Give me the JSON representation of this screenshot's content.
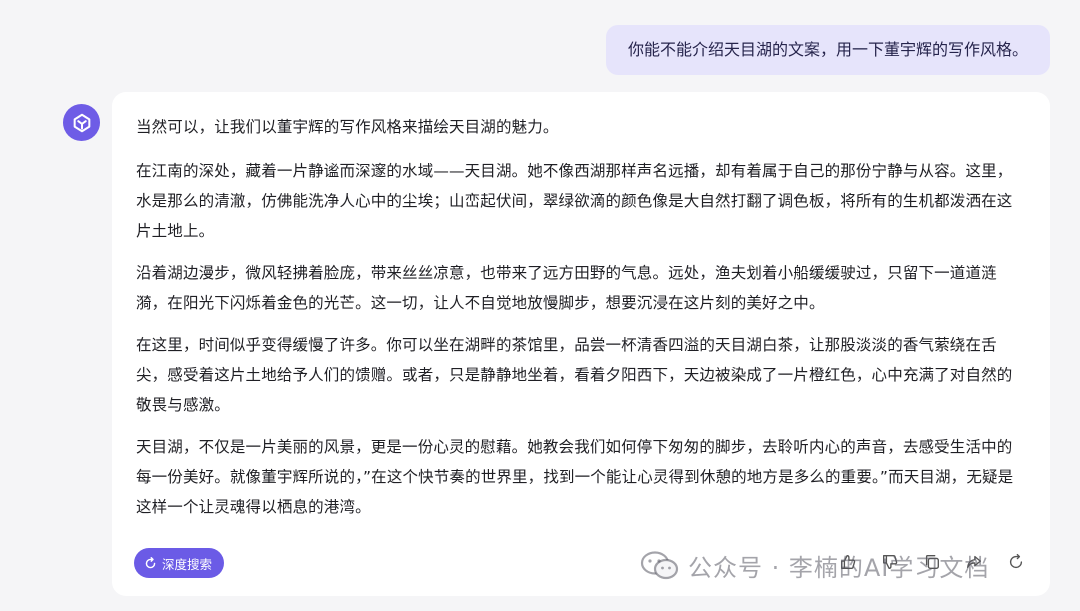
{
  "user_message": "你能不能介绍天目湖的文案，用一下董宇辉的写作风格。",
  "answer": {
    "intro": "当然可以，让我们以董宇辉的写作风格来描绘天目湖的魅力。",
    "paragraphs": [
      "在江南的深处，藏着一片静谧而深邃的水域——天目湖。她不像西湖那样声名远播，却有着属于自己的那份宁静与从容。这里，水是那么的清澈，仿佛能洗净人心中的尘埃；山峦起伏间，翠绿欲滴的颜色像是大自然打翻了调色板，将所有的生机都泼洒在这片土地上。",
      "沿着湖边漫步，微风轻拂着脸庞，带来丝丝凉意，也带来了远方田野的气息。远处，渔夫划着小船缓缓驶过，只留下一道道涟漪，在阳光下闪烁着金色的光芒。这一切，让人不自觉地放慢脚步，想要沉浸在这片刻的美好之中。",
      "在这里，时间似乎变得缓慢了许多。你可以坐在湖畔的茶馆里，品尝一杯清香四溢的天目湖白茶，让那股淡淡的香气萦绕在舌尖，感受着这片土地给予人们的馈赠。或者，只是静静地坐着，看着夕阳西下，天边被染成了一片橙红色，心中充满了对自然的敬畏与感激。",
      "天目湖，不仅是一片美丽的风景，更是一份心灵的慰藉。她教会我们如何停下匆匆的脚步，去聆听内心的声音，去感受生活中的每一份美好。就像董宇辉所说的，”在这个快节奏的世界里，找到一个能让心灵得到休憩的地方是多么的重要。”而天目湖，无疑是这样一个让灵魂得以栖息的港湾。"
    ]
  },
  "deep_search_label": "深度搜索",
  "actions": [
    "thumb-up-icon",
    "thumb-down-icon",
    "copy-icon",
    "share-icon",
    "regenerate-icon"
  ],
  "watermark": "公众号 · 李楠的AI学习文档",
  "colors": {
    "accent": "#6b5be6",
    "user_bubble": "#e6e4fb",
    "background": "#f5f5f7"
  }
}
